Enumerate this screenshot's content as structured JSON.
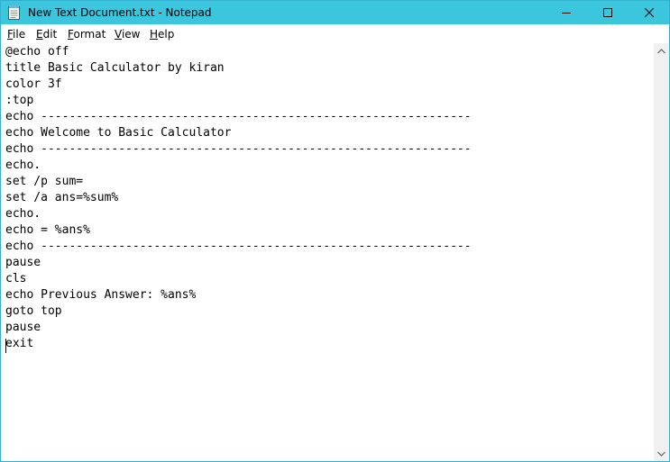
{
  "window": {
    "title": "New Text Document.txt - Notepad",
    "accent_color": "#3cc6de",
    "icons": {
      "app": "notepad-icon",
      "minimize": "minimize-icon",
      "maximize": "maximize-icon",
      "close": "close-icon"
    }
  },
  "menu": [
    {
      "accel": "F",
      "rest": "ile"
    },
    {
      "accel": "E",
      "rest": "dit"
    },
    {
      "accel": "F",
      "rest": "ormat"
    },
    {
      "accel": "V",
      "rest": "iew"
    },
    {
      "accel": "H",
      "rest": "elp"
    }
  ],
  "editor": {
    "lines": [
      "@echo off",
      "title Basic Calculator by kiran",
      "color 3f",
      ":top",
      "echo -------------------------------------------------------------",
      "echo Welcome to Basic Calculator",
      "echo -------------------------------------------------------------",
      "echo.",
      "set /p sum=",
      "set /a ans=%sum%",
      "echo.",
      "echo = %ans%",
      "echo -------------------------------------------------------------",
      "pause",
      "cls",
      "echo Previous Answer: %ans%",
      "goto top",
      "pause",
      "exit"
    ]
  }
}
